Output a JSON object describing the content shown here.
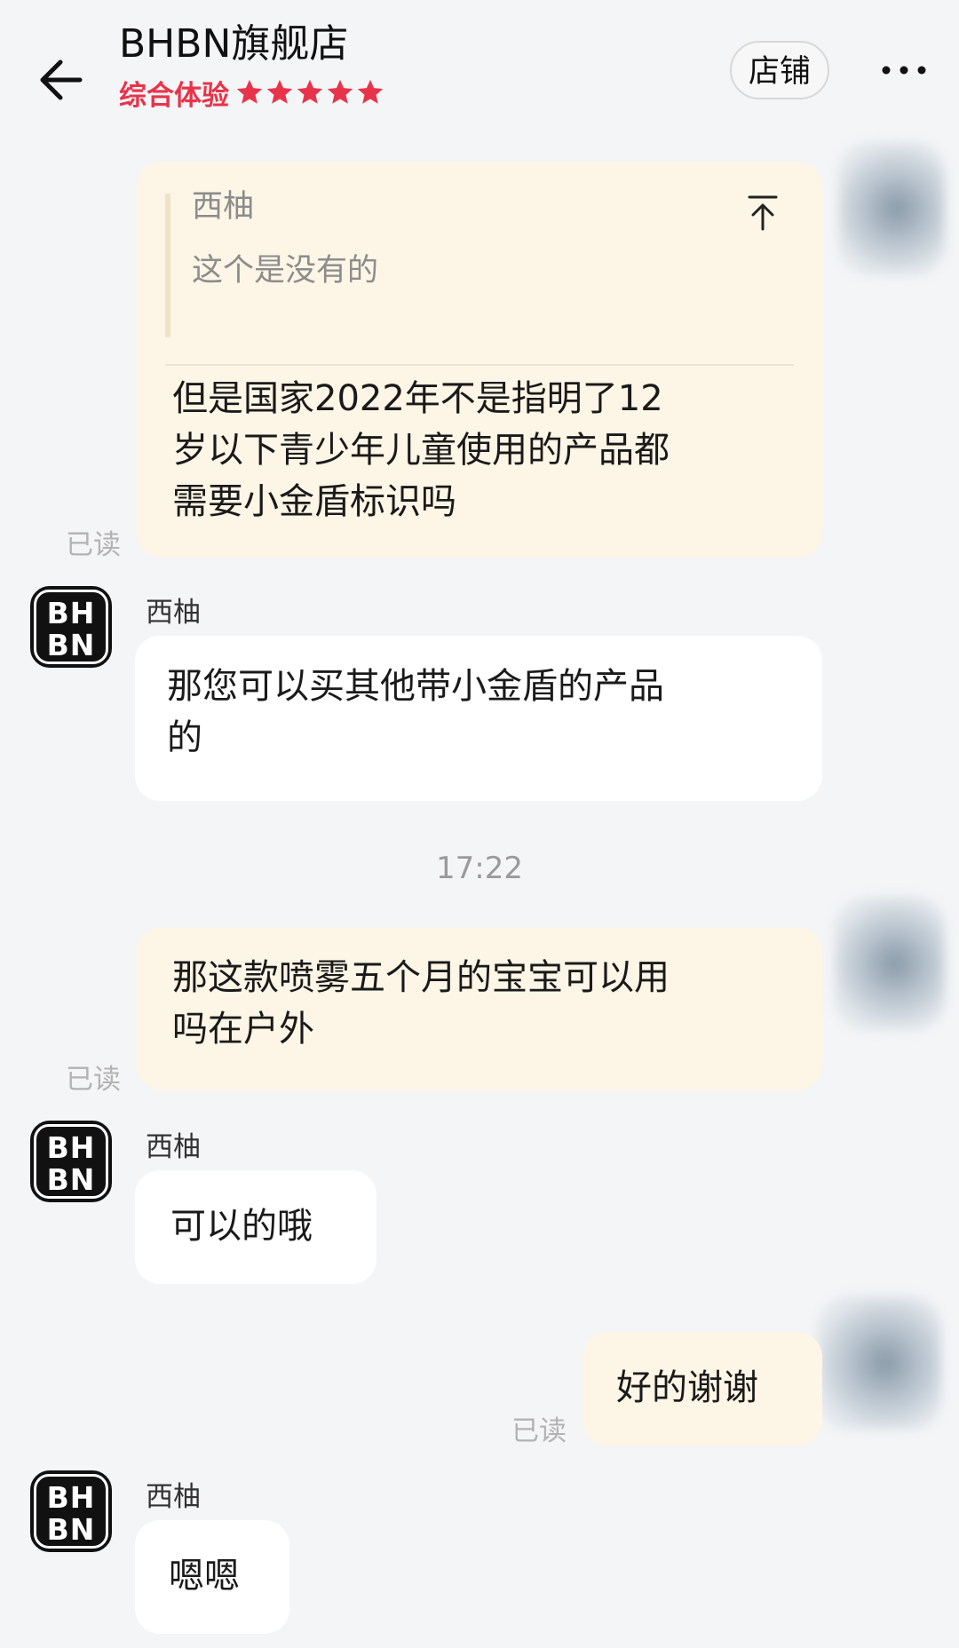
{
  "header": {
    "title": "BHBN旗舰店",
    "rating_label": "综合体验",
    "rating_stars": 5,
    "rating_max": 5,
    "shop_button": "店铺",
    "accent_color": "#e8344a"
  },
  "icons": {
    "back": "arrow-left-icon",
    "more": "more-dots-icon",
    "star": "star-icon",
    "quote_top": "arrow-to-top-icon"
  },
  "messages": {
    "m1": {
      "quote_name": "西柚",
      "quote_text": "这个是没有的",
      "text_lines": [
        "但是国家2022年不是指明了12",
        "岁以下青少年儿童使用的产品都",
        "需要小金盾标识吗"
      ],
      "status": "已读"
    },
    "m2": {
      "sender": "西柚",
      "logo": "BH BN",
      "text_lines": [
        "那您可以买其他带小金盾的产品",
        "的"
      ]
    },
    "timestamp": "17:22",
    "m3": {
      "text_lines": [
        "那这款喷雾五个月的宝宝可以用",
        "吗在户外"
      ],
      "status": "已读"
    },
    "m4": {
      "sender": "西柚",
      "logo": "BH BN",
      "text": "可以的哦"
    },
    "m5": {
      "text": "好的谢谢",
      "status": "已读"
    },
    "m6": {
      "sender": "西柚",
      "logo": "BH BN",
      "text": "嗯嗯"
    }
  }
}
